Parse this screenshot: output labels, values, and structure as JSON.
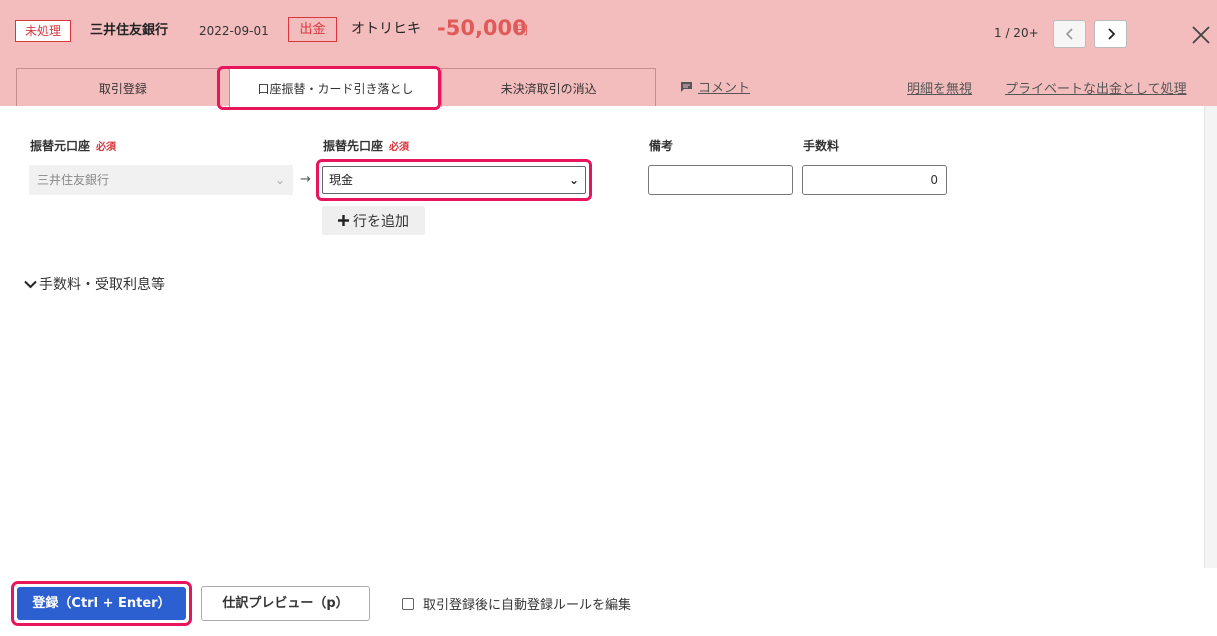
{
  "header": {
    "status": "未処理",
    "bank": "三井住友銀行",
    "date": "2022-09-01",
    "type": "出金",
    "payee": "オトリヒキ",
    "amount": "-50,000",
    "currency": "円",
    "pager": "1 / 20+"
  },
  "tabs": [
    {
      "label": "取引登録"
    },
    {
      "label": "口座振替・カード引き落とし"
    },
    {
      "label": "未決済取引の消込"
    }
  ],
  "links": {
    "comment": "コメント",
    "ignore": "明細を無視",
    "private": "プライベートな出金として処理"
  },
  "form": {
    "source_label": "振替元口座",
    "dest_label": "振替先口座",
    "required": "必須",
    "memo_label": "備考",
    "fee_label": "手数料",
    "source_value": "三井住友銀行",
    "dest_value": "現金",
    "memo_value": "",
    "fee_value": "0",
    "add_row": "行を追加",
    "fees_toggle": "手数料・受取利息等"
  },
  "footer": {
    "register": "登録（Ctrl + Enter）",
    "preview": "仕訳プレビュー（p）",
    "rule_edit": "取引登録後に自動登録ルールを編集"
  },
  "colors": {
    "header_bg": "#f4bdbd",
    "accent_red": "#d9363e",
    "highlight": "#e8155b",
    "primary_blue": "#2c5fd0"
  }
}
